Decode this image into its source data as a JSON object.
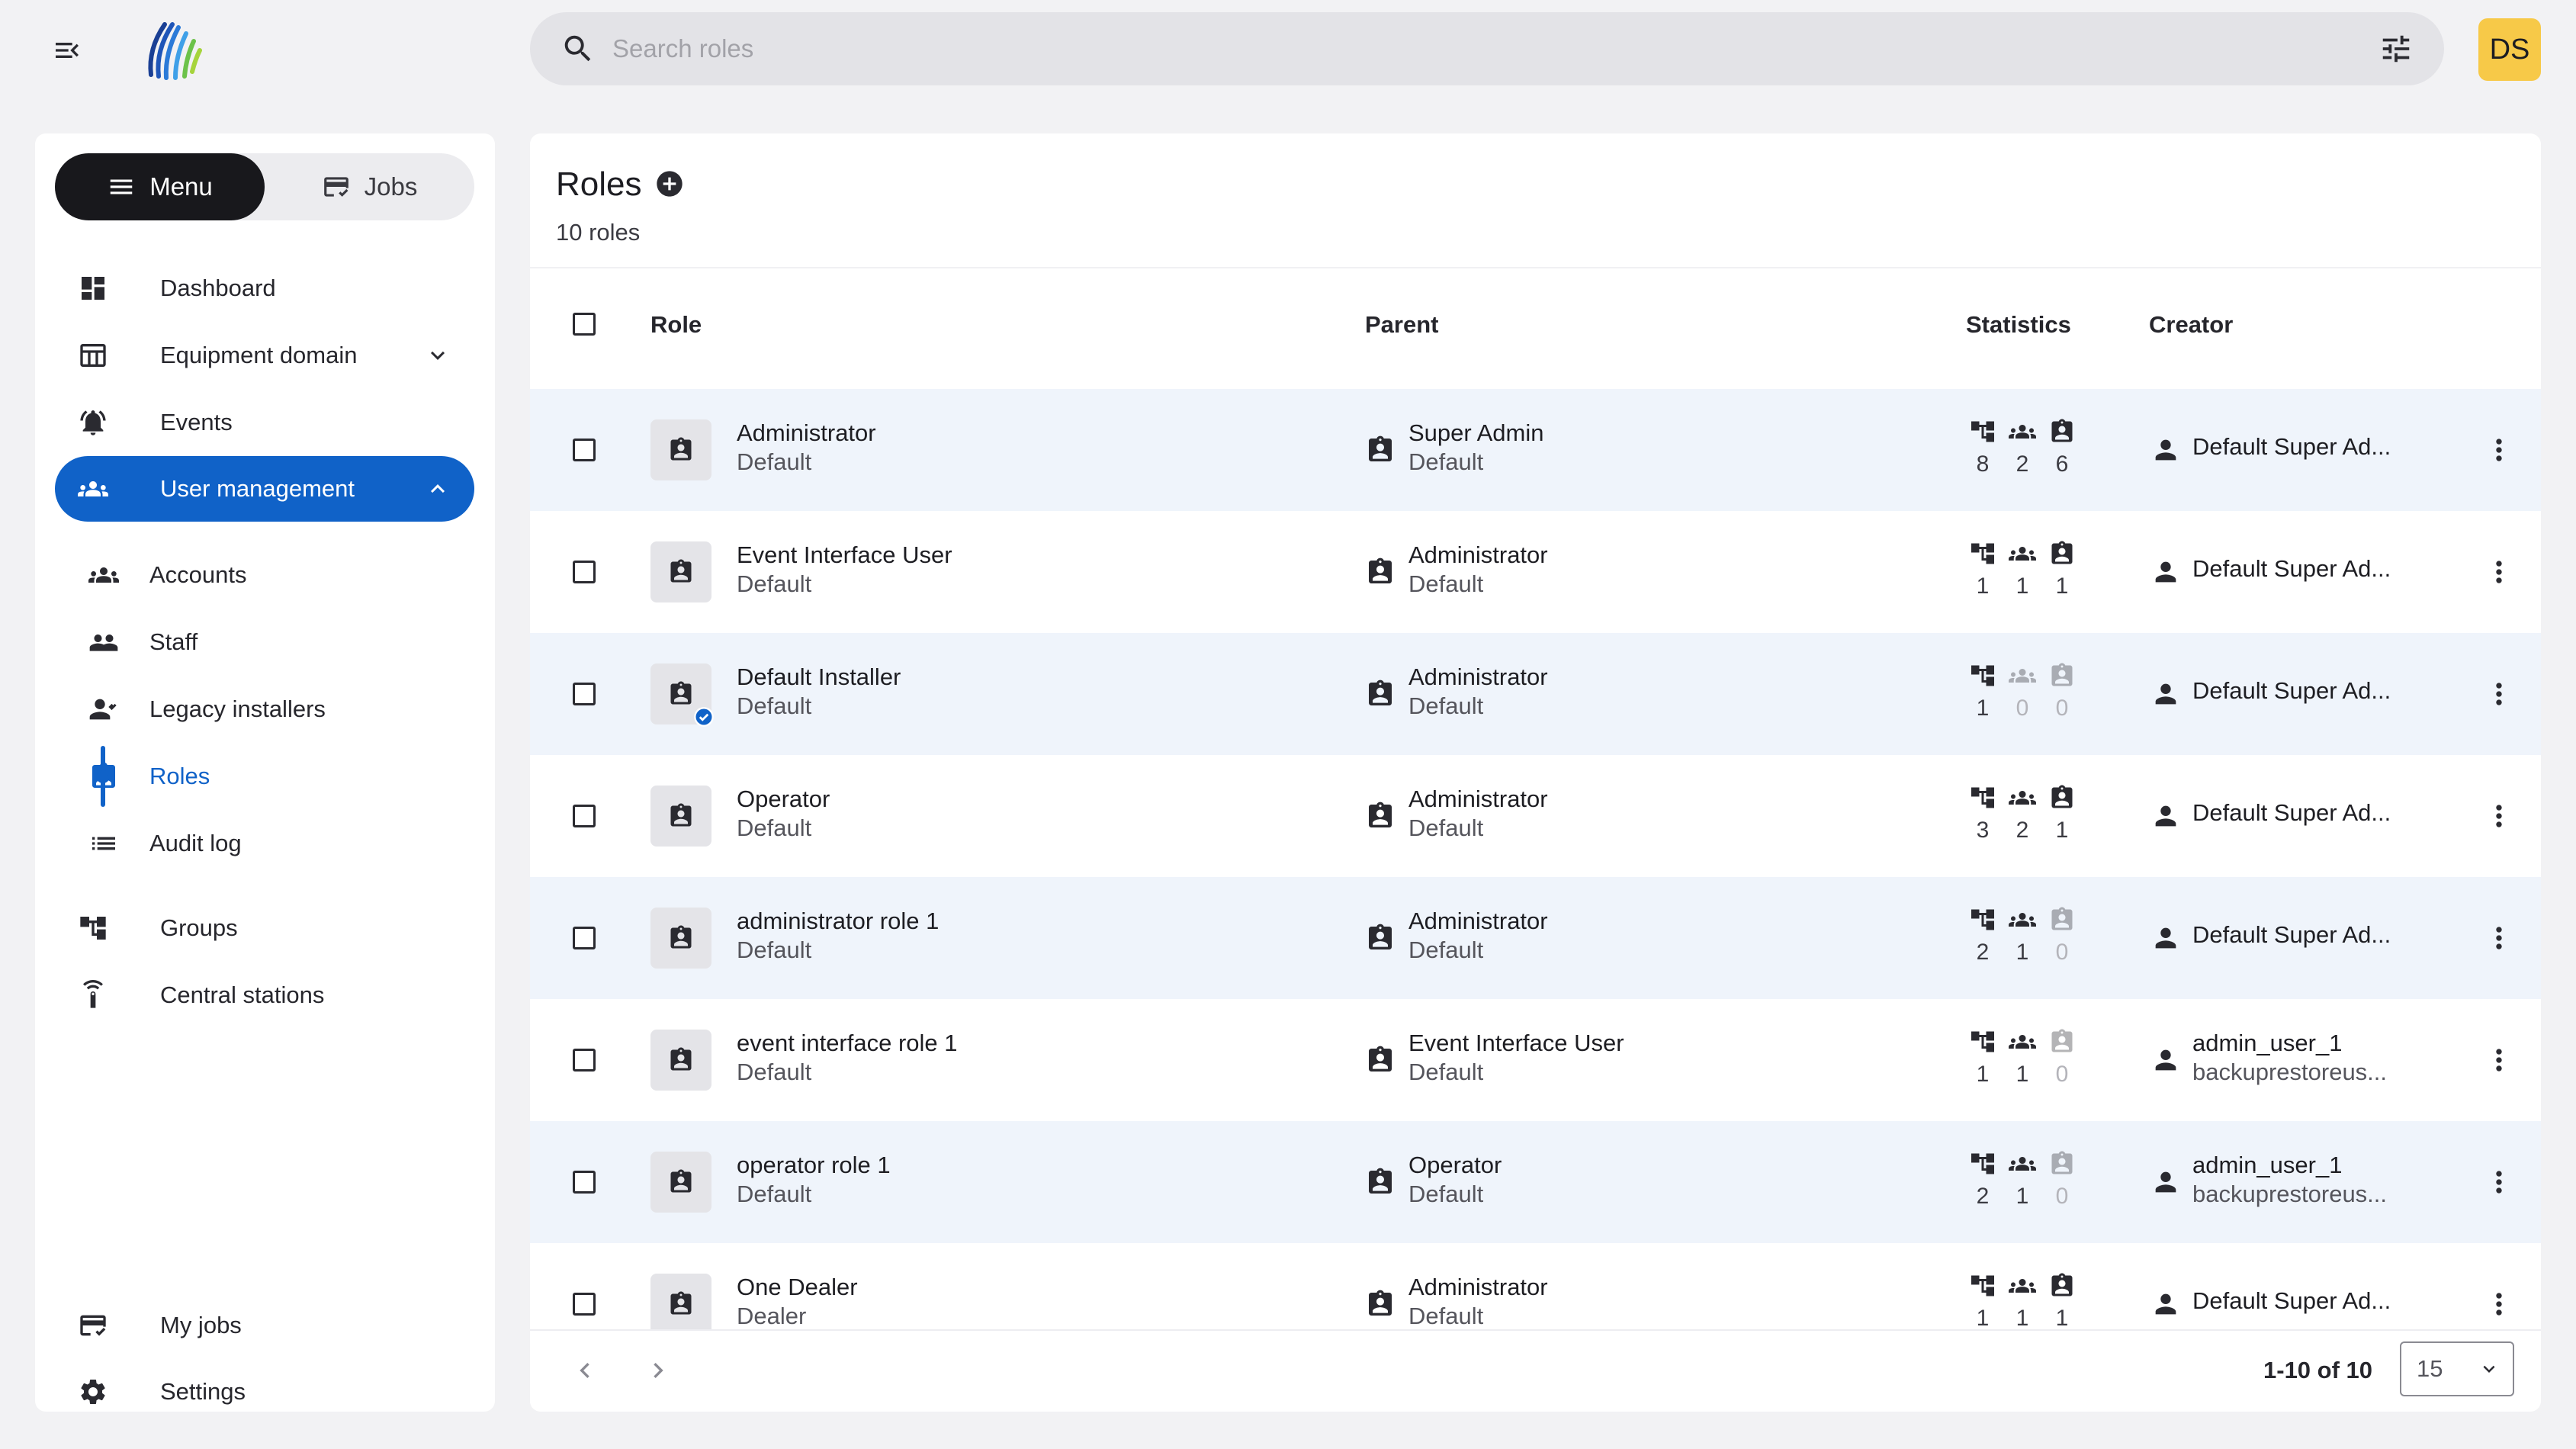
{
  "topbar": {
    "search_placeholder": "Search roles",
    "avatar_initials": "DS"
  },
  "sidebar": {
    "segment": {
      "menu_label": "Menu",
      "jobs_label": "Jobs"
    },
    "items": [
      {
        "label": "Dashboard",
        "icon": "dashboard-icon"
      },
      {
        "label": "Equipment domain",
        "icon": "equipment-icon"
      },
      {
        "label": "Events",
        "icon": "bell-icon"
      },
      {
        "label": "User management",
        "icon": "people-icon"
      },
      {
        "label": "Groups",
        "icon": "hierarchy-icon"
      },
      {
        "label": "Central stations",
        "icon": "station-icon"
      },
      {
        "label": "My jobs",
        "icon": "jobs-icon"
      },
      {
        "label": "Settings",
        "icon": "gear-icon"
      }
    ],
    "subitems": [
      {
        "label": "Accounts",
        "icon": "accounts-icon"
      },
      {
        "label": "Staff",
        "icon": "staff-icon"
      },
      {
        "label": "Legacy installers",
        "icon": "installer-icon"
      },
      {
        "label": "Roles",
        "icon": "badge-icon"
      },
      {
        "label": "Audit log",
        "icon": "list-icon"
      }
    ]
  },
  "main": {
    "title": "Roles",
    "count": "10 roles",
    "columns": {
      "role": "Role",
      "parent": "Parent",
      "statistics": "Statistics",
      "creator": "Creator"
    },
    "rows": [
      {
        "name": "Administrator",
        "type": "Default",
        "parent": "Super Admin",
        "parent_type": "Default",
        "stats": [
          "8",
          "2",
          "6"
        ],
        "creator": "Default Super Ad...",
        "creator_sub": ""
      },
      {
        "name": "Event Interface User",
        "type": "Default",
        "parent": "Administrator",
        "parent_type": "Default",
        "stats": [
          "1",
          "1",
          "1"
        ],
        "creator": "Default Super Ad...",
        "creator_sub": ""
      },
      {
        "name": "Default Installer",
        "type": "Default",
        "parent": "Administrator",
        "parent_type": "Default",
        "stats": [
          "1",
          "0",
          "0"
        ],
        "creator": "Default Super Ad...",
        "creator_sub": ""
      },
      {
        "name": "Operator",
        "type": "Default",
        "parent": "Administrator",
        "parent_type": "Default",
        "stats": [
          "3",
          "2",
          "1"
        ],
        "creator": "Default Super Ad...",
        "creator_sub": ""
      },
      {
        "name": "administrator role 1",
        "type": "Default",
        "parent": "Administrator",
        "parent_type": "Default",
        "stats": [
          "2",
          "1",
          "0"
        ],
        "creator": "Default Super Ad...",
        "creator_sub": ""
      },
      {
        "name": "event interface role 1",
        "type": "Default",
        "parent": "Event Interface User",
        "parent_type": "Default",
        "stats": [
          "1",
          "1",
          "0"
        ],
        "creator": "admin_user_1",
        "creator_sub": "backuprestoreus..."
      },
      {
        "name": "operator role 1",
        "type": "Default",
        "parent": "Operator",
        "parent_type": "Default",
        "stats": [
          "2",
          "1",
          "0"
        ],
        "creator": "admin_user_1",
        "creator_sub": "backuprestoreus..."
      },
      {
        "name": "One Dealer",
        "type": "Dealer",
        "parent": "Administrator",
        "parent_type": "Default",
        "stats": [
          "1",
          "1",
          "1"
        ],
        "creator": "Default Super Ad...",
        "creator_sub": ""
      }
    ],
    "pagination": {
      "range": "1-10 of 10",
      "per_page": "15"
    }
  },
  "colors": {
    "accent": "#1062c8",
    "avatar_bg": "#f7c948",
    "row_alt": "#eff4fb"
  }
}
